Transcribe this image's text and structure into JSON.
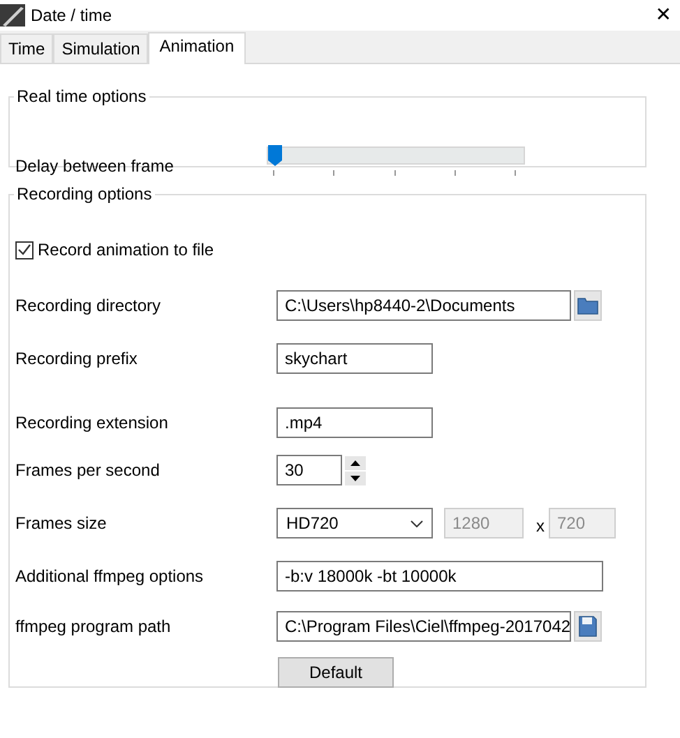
{
  "window": {
    "title": "Date / time",
    "close": "✕"
  },
  "tabs": [
    {
      "label": "Time",
      "selected": false
    },
    {
      "label": "Simulation",
      "selected": false
    },
    {
      "label": "Animation",
      "selected": true
    }
  ],
  "real_time_options": {
    "title": "Real time options",
    "delay_label": "Delay between frame",
    "delay_slider": {
      "level": 0
    }
  },
  "recording_options": {
    "title": "Recording options",
    "record_to_file": {
      "label": "Record animation to file",
      "checked": true
    },
    "fields": [
      {
        "kind": "folder",
        "label": "Recording directory",
        "value": "C:\\Users\\hp8440-2\\Documents"
      },
      {
        "kind": "text",
        "label": "Recording prefix",
        "value": "skychart"
      },
      {
        "kind": "text",
        "label": "Recording extension",
        "value": ".mp4"
      },
      {
        "kind": "spin",
        "label": "Frames per second",
        "value": "30"
      },
      {
        "kind": "size",
        "label": "Frames size",
        "value": "HD720",
        "separator": "x",
        "width": {
          "value": "1280",
          "disabled": true
        },
        "height": {
          "value": "720",
          "disabled": true
        }
      },
      {
        "kind": "wide",
        "label": "Additional ffmpeg options",
        "value": "-b:v 18000k -bt 10000k"
      },
      {
        "kind": "file",
        "label": "ffmpeg program path",
        "value": "C:\\Program Files\\Ciel\\ffmpeg-2017042"
      }
    ],
    "default_button": "Default"
  }
}
